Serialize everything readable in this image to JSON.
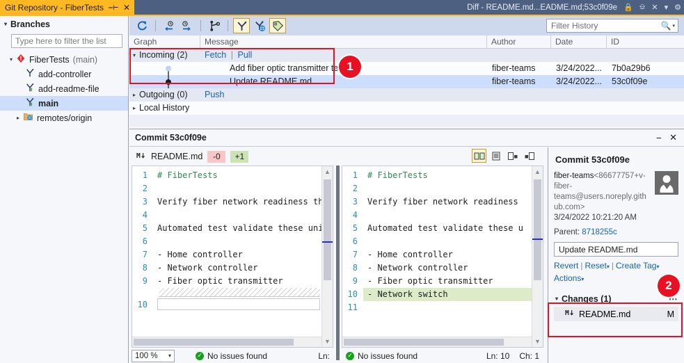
{
  "window": {
    "tool_tab_title": "Git Repository - FiberTests",
    "pin_icon": "pin-icon",
    "close_icon": "close-icon",
    "document_tab_title": "Diff - README.md...EADME.md;53c0f09e",
    "lock_icon": "lock-icon",
    "float_icon": "float-window-icon",
    "tab_close_icon": "close-icon",
    "dropdown_icon": "chevron-down-icon",
    "settings_icon": "gear-icon"
  },
  "sidebar": {
    "header": "Branches",
    "filter_placeholder": "Type here to filter the list",
    "filter_value": "",
    "tree": [
      {
        "label": "FiberTests",
        "suffix": "(main)",
        "icon": "repository-icon",
        "expander": "down",
        "level": 0
      },
      {
        "label": "add-controller",
        "icon": "branch-icon",
        "expander": "none",
        "level": 1
      },
      {
        "label": "add-readme-file",
        "icon": "branch-tracking-icon",
        "expander": "none",
        "level": 1
      },
      {
        "label": "main",
        "icon": "branch-tracking-icon",
        "expander": "none",
        "level": 1,
        "selected": true,
        "bold": true
      },
      {
        "label": "remotes/origin",
        "icon": "remote-folder-icon",
        "expander": "right",
        "level": 1
      }
    ]
  },
  "history_toolbar": {
    "buttons": [
      {
        "name": "refresh-icon",
        "active": false
      },
      {
        "name": "fetch-incoming-icon",
        "active": false
      },
      {
        "name": "push-outgoing-icon",
        "active": false
      },
      {
        "name": "branch-graph-icon",
        "active": false
      },
      {
        "name": "show-local-branches-icon",
        "active": true
      },
      {
        "name": "show-remote-branches-icon",
        "active": false
      },
      {
        "name": "show-tags-icon",
        "active": true
      }
    ],
    "filter_placeholder": "Filter History",
    "filter_value": "",
    "search_icon": "search-icon"
  },
  "history": {
    "columns": [
      "Graph",
      "Message",
      "Author",
      "Date",
      "ID"
    ],
    "rows": [
      {
        "type": "group",
        "expander": "down",
        "label": "Incoming (2)",
        "links": [
          "Fetch",
          "Pull"
        ],
        "author": "",
        "date": "",
        "id": ""
      },
      {
        "type": "commit",
        "node": "hollow",
        "message": "Add fiber optic transmitter test",
        "author": "fiber-teams",
        "date": "3/24/2022...",
        "id": "7b0a29b6",
        "selected": false
      },
      {
        "type": "commit",
        "node": "filled",
        "message": "Update README.md",
        "author": "fiber-teams",
        "date": "3/24/2022...",
        "id": "53c0f09e",
        "selected": true
      },
      {
        "type": "group",
        "expander": "right",
        "label": "Outgoing (0)",
        "links": [
          "Push"
        ],
        "author": "",
        "date": "",
        "id": ""
      },
      {
        "type": "group",
        "expander": "right",
        "label": "Local History",
        "links": [],
        "author": "",
        "date": "",
        "id": ""
      }
    ]
  },
  "callouts": [
    {
      "number": "1"
    },
    {
      "number": "2"
    }
  ],
  "diff_window": {
    "title": "Commit 53c0f09e",
    "minimize_icon": "minimize-icon",
    "close_icon": "close-icon",
    "file_icon": "markdown-file-icon",
    "file_name": "README.md",
    "removed_badge": "-0",
    "added_badge": "+1",
    "view_buttons": [
      {
        "name": "side-by-side-view-icon",
        "active": true
      },
      {
        "name": "inline-view-icon",
        "active": false
      },
      {
        "name": "left-only-view-icon",
        "active": false
      },
      {
        "name": "right-only-view-icon",
        "active": false
      }
    ],
    "left_pane": {
      "lines": [
        {
          "num": "1",
          "text": "# FiberTests",
          "style": "heading"
        },
        {
          "num": "2",
          "text": ""
        },
        {
          "num": "3",
          "text": "Verify fiber network readiness th"
        },
        {
          "num": "4",
          "text": ""
        },
        {
          "num": "5",
          "text": "Automated test validate these uni"
        },
        {
          "num": "6",
          "text": ""
        },
        {
          "num": "7",
          "text": "- Home controller"
        },
        {
          "num": "8",
          "text": "- Network controller"
        },
        {
          "num": "9",
          "text": "- Fiber optic transmitter"
        },
        {
          "num": "10",
          "text": "",
          "kind": "empty-box"
        }
      ],
      "status": {
        "zoom": "100 %",
        "issues": "No issues found",
        "ln_label": "Ln:"
      }
    },
    "right_pane": {
      "lines": [
        {
          "num": "1",
          "text": "# FiberTests",
          "style": "heading"
        },
        {
          "num": "2",
          "text": ""
        },
        {
          "num": "3",
          "text": "Verify fiber network readiness"
        },
        {
          "num": "4",
          "text": ""
        },
        {
          "num": "5",
          "text": "Automated test validate these u"
        },
        {
          "num": "6",
          "text": ""
        },
        {
          "num": "7",
          "text": "- Home controller"
        },
        {
          "num": "8",
          "text": "- Network controller"
        },
        {
          "num": "9",
          "text": "- Fiber optic transmitter"
        },
        {
          "num": "10",
          "text": "- Network switch",
          "kind": "added"
        },
        {
          "num": "11",
          "text": ""
        }
      ],
      "status": {
        "issues": "No issues found",
        "ln": "Ln: 10",
        "ch": "Ch: 1"
      }
    }
  },
  "commit_details": {
    "title": "Commit 53c0f09e",
    "author_name": "fiber-teams",
    "author_email": "<86677757+v-fiber-teams@users.noreply.github.com>",
    "timestamp": "3/24/2022 10:21:20 AM",
    "parent_label": "Parent:",
    "parent_id": "8718255c",
    "message_value": "Update README.md",
    "actions": [
      {
        "label": "Revert",
        "caret": false
      },
      {
        "label": "Reset",
        "caret": true
      },
      {
        "label": "Create Tag",
        "caret": true
      },
      {
        "label": "Actions",
        "caret": true
      }
    ],
    "changes_header": "Changes (1)",
    "changes_more_icon": "more-options-icon",
    "changes": [
      {
        "icon": "markdown-file-icon",
        "name": "README.md",
        "status": "M"
      }
    ],
    "avatar_icon": "user-avatar-icon"
  },
  "colors": {
    "accent_gold": "#fdb822",
    "titlebar": "#4d6082",
    "link": "#1763b5",
    "selection": "#cddefc",
    "callout_red": "#e81123",
    "added_green": "#ddebc8",
    "badge_minus": "#f7c7c7",
    "badge_plus": "#cde3b6"
  }
}
